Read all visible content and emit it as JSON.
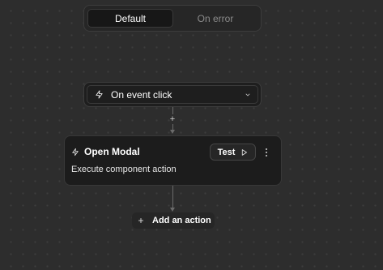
{
  "tabs": [
    {
      "label": "Default",
      "active": true
    },
    {
      "label": "On error",
      "active": false
    }
  ],
  "trigger": {
    "icon": "lightning-icon",
    "label": "On event click",
    "chevron": "chevron-down-icon"
  },
  "connector": {
    "insert_symbol": "+"
  },
  "action": {
    "icon": "lightning-icon",
    "title": "Open Modal",
    "description": "Execute component action",
    "test_label": "Test",
    "test_icon": "play-icon",
    "menu_icon": "more-vertical-icon"
  },
  "add_action": {
    "symbol": "+",
    "label": "Add an action"
  },
  "colors": {
    "canvas": "#2d2d2d",
    "node": "#1c1c1c",
    "border": "#383838",
    "muted_text": "#8a8a8a"
  }
}
